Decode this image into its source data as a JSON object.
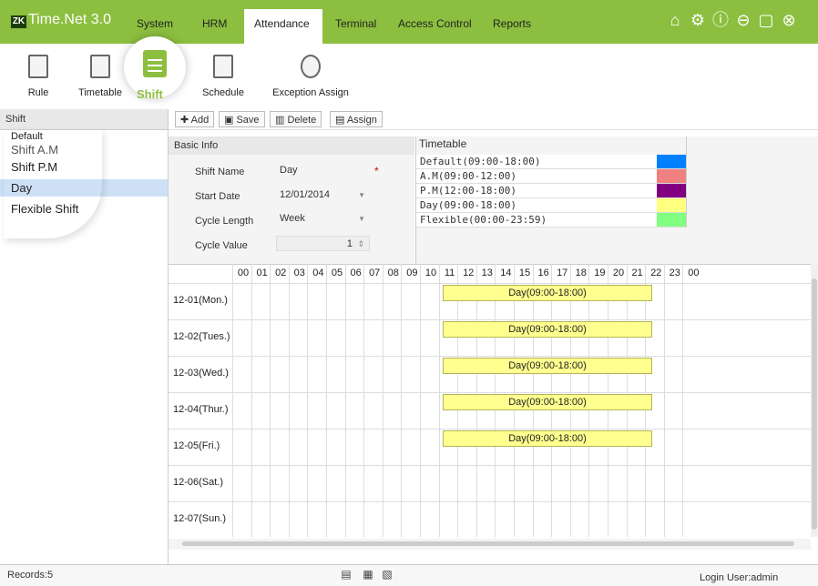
{
  "app": {
    "logo_text": "ZK",
    "title": "Time.Net 3.0"
  },
  "menu": [
    "System",
    "HRM",
    "Attendance",
    "Terminal",
    "Access Control",
    "Reports"
  ],
  "window_icons": [
    "home-icon",
    "gear-icon",
    "help-icon",
    "minimize-icon",
    "maximize-icon",
    "close-icon"
  ],
  "toolbar": {
    "rule": "Rule",
    "timetable": "Timetable",
    "shift": "Shift",
    "schedule": "Schedule",
    "exception": "Exception Assign"
  },
  "left_panel": {
    "header": "Shift",
    "items": [
      "Default",
      "Shift A.M",
      "Shift P.M",
      "Day",
      "Flexible Shift"
    ]
  },
  "actions": {
    "add": "Add",
    "save": "Save",
    "delete": "Delete",
    "assign": "Assign"
  },
  "basic_info": {
    "header": "Basic Info",
    "shift_name_label": "Shift Name",
    "shift_name": "Day",
    "start_date_label": "Start Date",
    "start_date": "12/01/2014",
    "cycle_length_label": "Cycle Length",
    "cycle_length": "Week",
    "cycle_value_label": "Cycle Value",
    "cycle_value": "1",
    "required_mark": "*"
  },
  "timetable": {
    "header": "Timetable",
    "rows": [
      {
        "label": "Default(09:00-18:00)",
        "color": "#0080ff"
      },
      {
        "label": "A.M(09:00-12:00)",
        "color": "#f08080"
      },
      {
        "label": "P.M(12:00-18:00)",
        "color": "#800080"
      },
      {
        "label": "Day(09:00-18:00)",
        "color": "#ffff80"
      },
      {
        "label": "Flexible(00:00-23:59)",
        "color": "#80ff80"
      }
    ]
  },
  "schedule": {
    "hours": [
      "00",
      "01",
      "02",
      "03",
      "04",
      "05",
      "06",
      "07",
      "08",
      "09",
      "10",
      "11",
      "12",
      "13",
      "14",
      "15",
      "16",
      "17",
      "18",
      "19",
      "20",
      "21",
      "22",
      "23",
      "00"
    ],
    "days": [
      "12-01(Mon.)",
      "12-02(Tues.)",
      "12-03(Wed.)",
      "12-04(Thur.)",
      "12-05(Fri.)",
      "12-06(Sat.)",
      "12-07(Sun.)"
    ],
    "bar_label": "Day(09:00-18:00)",
    "bar_days": [
      0,
      1,
      2,
      3,
      4
    ]
  },
  "status": {
    "records": "Records:5",
    "login": "Login User:admin"
  }
}
